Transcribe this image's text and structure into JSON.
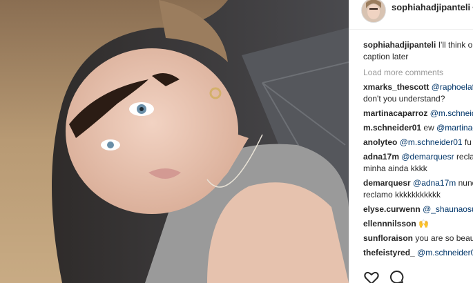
{
  "header": {
    "username": "sophiahadjipanteli",
    "separator": "•"
  },
  "caption": {
    "username": "sophiahadjipanteli",
    "text_line1": "I'll think o",
    "text_line2": "caption later"
  },
  "load_more": "Load more comments",
  "comments": [
    {
      "user": "xmarks_thescott",
      "mention": "@raphoelafi",
      "line2": "don't you understand?"
    },
    {
      "user": "martinacaparroz",
      "mention": "@m.schneid"
    },
    {
      "user": "m.schneider01",
      "text": "ew",
      "mention": "@martinac"
    },
    {
      "user": "anolyteo",
      "mention": "@m.schneider01",
      "text": "fu"
    },
    {
      "user": "adna17m",
      "mention": "@demarquesr",
      "text": "recla",
      "line2": "minha ainda kkkk"
    },
    {
      "user": "demarquesr",
      "mention": "@adna17m",
      "text": "nund",
      "line2": "reclamo kkkkkkkkkkk"
    },
    {
      "user": "elyse.curwenn",
      "mention": "@_shaunaosu"
    },
    {
      "user": "ellennnilsson",
      "emoji": "🙌"
    },
    {
      "user": "sunfloraison",
      "text": "you are so beau"
    },
    {
      "user": "thefeistyred_",
      "mention": "@m.schneider0"
    }
  ],
  "actions": [
    "heart-icon",
    "comment-icon"
  ],
  "colors": {
    "text": "#262626",
    "link": "#003569",
    "muted": "#999999",
    "divider": "#efefef"
  }
}
